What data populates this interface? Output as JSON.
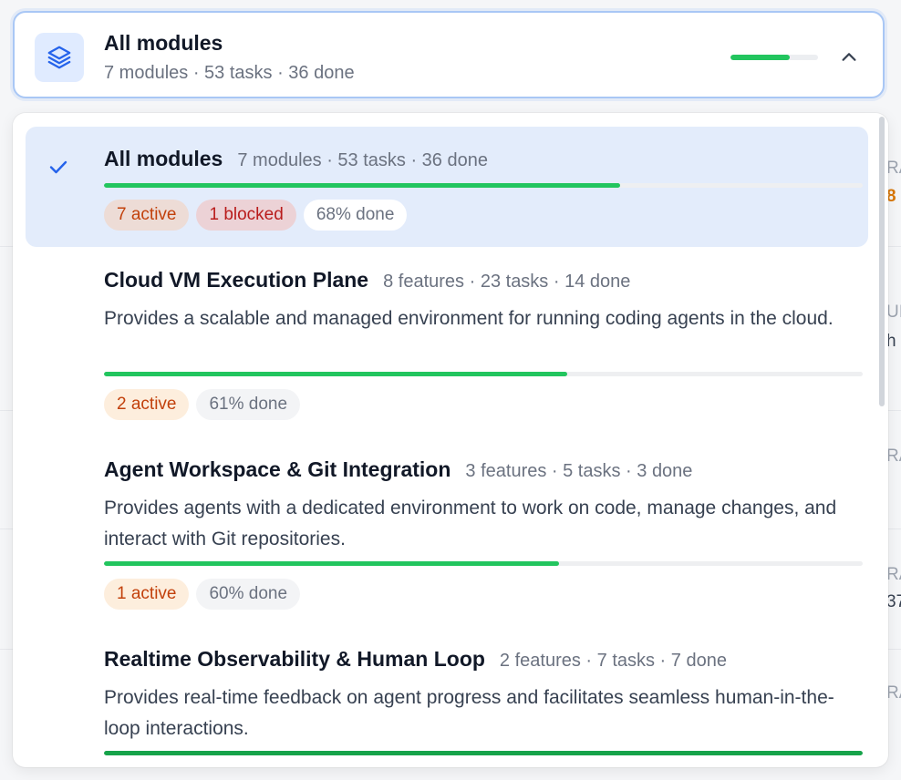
{
  "selector": {
    "icon": "layers-icon",
    "title": "All modules",
    "meta": "7 modules · 53 tasks · 36 done",
    "progress": 0.68,
    "chevron": "chevron-up-icon"
  },
  "options": [
    {
      "title": "All modules",
      "meta": "7 modules · 53 tasks · 36 done",
      "selected": true,
      "progress": 0.68,
      "badges": {
        "active": "7 active",
        "blocked": "1 blocked",
        "done": "68% done"
      }
    },
    {
      "title": "Cloud VM Execution Plane",
      "meta": "8 features · 23 tasks · 14 done",
      "description": "Provides a scalable and managed environment for running coding agents in the cloud.",
      "progress": 0.61,
      "badges": {
        "active": "2 active",
        "done": "61% done"
      }
    },
    {
      "title": "Agent Workspace & Git Integration",
      "meta": "3 features · 5 tasks · 3 done",
      "description": "Provides agents with a dedicated environment to work on code, manage changes, and interact with Git repositories.",
      "progress": 0.6,
      "badges": {
        "active": "1 active",
        "done": "60% done"
      }
    },
    {
      "title": "Realtime Observability & Human Loop",
      "meta": "2 features · 7 tasks · 7 done",
      "description": "Provides real-time feedback on agent progress and facilitates seamless human-in-the-loop interactions.",
      "progress": 1.0
    }
  ],
  "background_fragments": [
    "RA",
    "8",
    "UI",
    "h",
    "RA",
    "RA",
    "37",
    "RA"
  ]
}
